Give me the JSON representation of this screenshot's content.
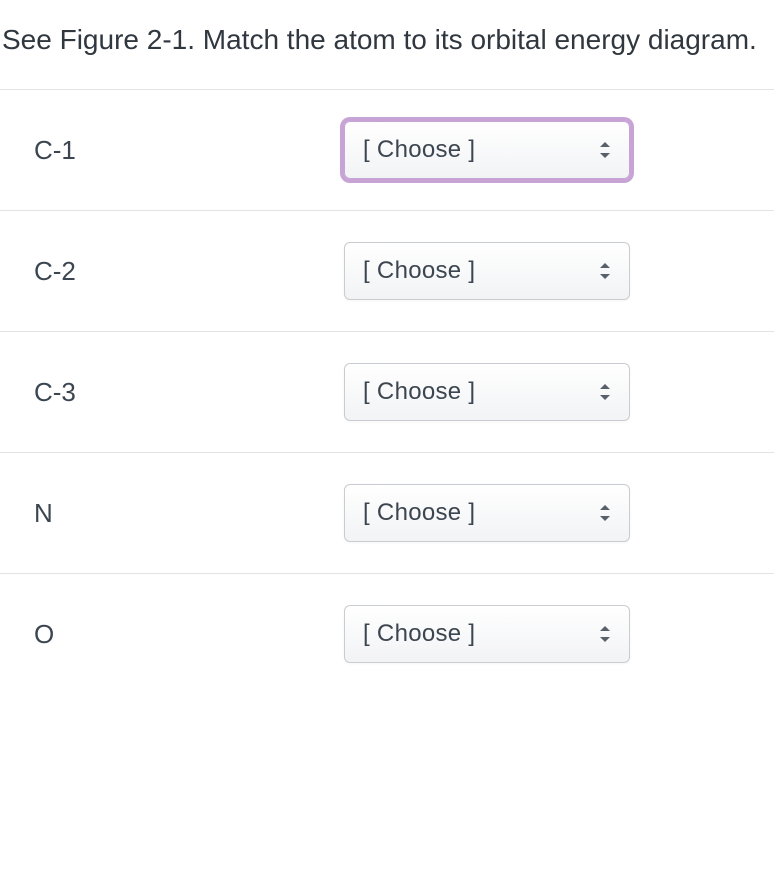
{
  "question": "See Figure 2-1.  Match the atom to its orbital energy diagram.",
  "choose_placeholder": "[ Choose ]",
  "focus_color": "#c7a3d6",
  "rows": [
    {
      "label": "C-1",
      "value": "[ Choose ]",
      "focused": true
    },
    {
      "label": "C-2",
      "value": "[ Choose ]",
      "focused": false
    },
    {
      "label": "C-3",
      "value": "[ Choose ]",
      "focused": false
    },
    {
      "label": "N",
      "value": "[ Choose ]",
      "focused": false
    },
    {
      "label": "O",
      "value": "[ Choose ]",
      "focused": false
    }
  ]
}
